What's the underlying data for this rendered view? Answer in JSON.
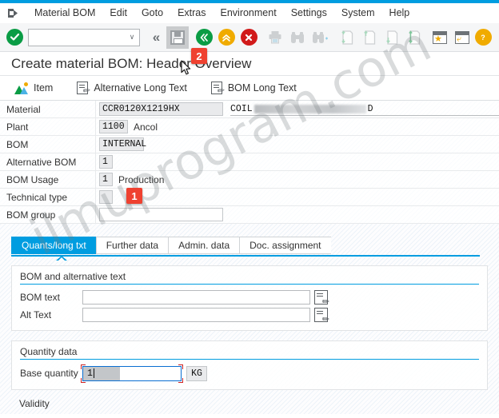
{
  "window": {
    "accent_color": "#009de0",
    "title": "Create material BOM: Header Overview"
  },
  "menubar": {
    "system_icon": "system-menu-icon",
    "items": [
      {
        "label": "Material BOM"
      },
      {
        "label": "Edit"
      },
      {
        "label": "Goto"
      },
      {
        "label": "Extras"
      },
      {
        "label": "Environment"
      },
      {
        "label": "Settings"
      },
      {
        "label": "System"
      },
      {
        "label": "Help"
      }
    ]
  },
  "toolbar": {
    "enter_label": "✔",
    "command_value": "",
    "command_placeholder": "",
    "dropdown_glyph": "∨",
    "back_chevrons_glyph": "«",
    "save_tooltip": "Save",
    "back_glyph": "«",
    "exit_glyph": "⌃",
    "cancel_glyph": "✕",
    "page_icons": [
      "first-page-icon",
      "previous-page-icon",
      "next-page-icon",
      "last-page-icon"
    ],
    "window_icons": [
      "create-shortcut-icon",
      "customize-local-layout-icon"
    ]
  },
  "app_toolbar": {
    "buttons": [
      {
        "label": "Item",
        "icon": "item-overview-icon"
      },
      {
        "label": "Alternative Long Text",
        "icon": "long-text-icon"
      },
      {
        "label": "BOM Long Text",
        "icon": "long-text-icon"
      }
    ]
  },
  "header_form": {
    "rows": [
      {
        "label": "Material",
        "value": "CCR0120X1219HX",
        "description_prefix": "COIL",
        "description_suffix": "D",
        "redacted": true
      },
      {
        "label": "Plant",
        "value": "1100",
        "side_text": "Ancol"
      },
      {
        "label": "BOM",
        "value": "INTERNAL"
      },
      {
        "label": "Alternative BOM",
        "value": "1"
      },
      {
        "label": "BOM Usage",
        "value": "1",
        "side_text": "Production"
      },
      {
        "label": "Technical type",
        "value": ""
      },
      {
        "label": "BOM group",
        "value": ""
      }
    ]
  },
  "tabs": [
    {
      "label": "Quants/long txt",
      "active": true
    },
    {
      "label": "Further data",
      "active": false
    },
    {
      "label": "Admin. data",
      "active": false
    },
    {
      "label": "Doc. assignment",
      "active": false
    }
  ],
  "text_group": {
    "title": "BOM and alternative text",
    "fields": [
      {
        "label": "BOM text",
        "value": ""
      },
      {
        "label": "Alt Text",
        "value": ""
      }
    ]
  },
  "quantity_group": {
    "title": "Quantity data",
    "label": "Base quantity",
    "value": "1",
    "unit": "KG"
  },
  "validity": {
    "label": "Validity"
  },
  "annotations": [
    {
      "number": "1",
      "target": "base-quantity-field"
    },
    {
      "number": "2",
      "target": "save-button"
    }
  ],
  "watermark": {
    "text": "ilmuprogram.com"
  }
}
